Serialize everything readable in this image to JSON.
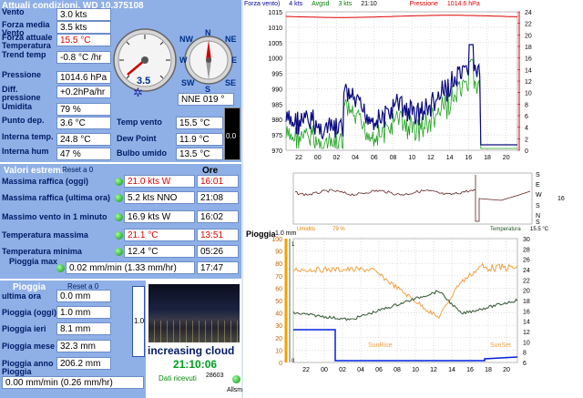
{
  "header": {
    "title": "Attuali condizioni, WD 10.375108"
  },
  "current": [
    {
      "label": "Vento",
      "value": "3.0 kts",
      "cls": ""
    },
    {
      "label": "Forza media Vento",
      "value": "3.5 kts",
      "cls": ""
    },
    {
      "label": "Forza attuale Temperatura",
      "value": "15.5 °C",
      "cls": "red"
    },
    {
      "label": "Trend temp",
      "value": "-0.8 °C /hr",
      "cls": ""
    },
    {
      "label": "Pressione",
      "value": "1014.6 hPa",
      "cls": ""
    },
    {
      "label": "Diff. pressione",
      "value": "+0.2hPa/hr",
      "cls": ""
    },
    {
      "label": "Umidita",
      "value": "79 %",
      "cls": ""
    },
    {
      "label": "Punto dep.",
      "value": "3.6 °C",
      "cls": ""
    },
    {
      "label": "Interna temp.",
      "value": "24.8 °C",
      "cls": ""
    },
    {
      "label": "Interna hum",
      "value": "47 %",
      "cls": ""
    }
  ],
  "gauges": {
    "speed_value": "3.5",
    "direction_text": "NNE 019 °",
    "side_value": "0.0",
    "compass": [
      "N",
      "NE",
      "E",
      "SE",
      "S",
      "SW",
      "W",
      "NW"
    ]
  },
  "derived": [
    {
      "label": "Temp vento",
      "value": "15.5 °C"
    },
    {
      "label": "Dew Point",
      "value": "11.9 °C"
    },
    {
      "label": "Bulbo umido",
      "value": "13.5 °C"
    }
  ],
  "extremes": {
    "title": "Valori estremi",
    "reset": "Reset a 0",
    "ore_label": "Ore",
    "rows": [
      {
        "label": "Massima raffica (oggi)",
        "value": "21.0 kts  W",
        "cls": "red",
        "time": "16:01",
        "time_cls": "red"
      },
      {
        "label": "Massima raffica (ultima ora)",
        "value": "5.2 kts NNO",
        "cls": "",
        "time": "21:08",
        "time_cls": ""
      },
      {
        "label": "Massimo vento in 1 minuto",
        "value": "16.9 kts  W",
        "cls": "",
        "time": "16:02",
        "time_cls": ""
      },
      {
        "label": "Temperatura massima",
        "value": "21.1 °C",
        "cls": "red",
        "time": "13:51",
        "time_cls": "red"
      },
      {
        "label": "Temperatura minima",
        "value": "12.4 °C",
        "cls": "",
        "time": "05:26",
        "time_cls": ""
      },
      {
        "label": "Pioggia max",
        "value": "0.02 mm/min (1.33 mm/hr)",
        "cls": "",
        "time": "17:47",
        "time_cls": ""
      }
    ]
  },
  "rain": {
    "title": "Pioggia",
    "reset": "Reset a 0",
    "rows": [
      {
        "label": "ultima ora",
        "value": "0.0 mm"
      },
      {
        "label": "Pioggia (oggi)",
        "value": "1.0 mm"
      },
      {
        "label": "Pioggia ieri",
        "value": "8.1 mm"
      },
      {
        "label": "Pioggia mese",
        "value": "32.3 mm"
      },
      {
        "label": "Pioggia anno",
        "value": "206.2 mm"
      }
    ],
    "rate_label": "Pioggia",
    "rate_value": "0.00 mm/min (0.26 mm/hr)",
    "bar_value": "1.0"
  },
  "webcam": {
    "caption": "increasing cloud",
    "time": "21:10:06",
    "received_label": "Dati ricevuti",
    "received_count": "28603",
    "alarm": "Allsm"
  },
  "chart_top": {
    "legend": [
      {
        "text": "Forza vento)",
        "color": "#0000a0"
      },
      {
        "text": "4 kts",
        "color": "#0000a0"
      },
      {
        "text": "Avgsd",
        "color": "#008000"
      },
      {
        "text": "3 kts",
        "color": "#008000"
      },
      {
        "text": "21:10",
        "color": "#000"
      },
      {
        "text": "Pressione",
        "color": "#e00000"
      },
      {
        "text": "1014.6 hPa",
        "color": "#e00000"
      }
    ],
    "y_left": [
      "1015",
      "1010",
      "1005",
      "1000",
      "995",
      "990",
      "985",
      "980",
      "975",
      "970"
    ],
    "y_right": [
      "24",
      "22",
      "20",
      "18",
      "16",
      "14",
      "12",
      "10",
      "8",
      "6",
      "4",
      "2",
      "0"
    ],
    "x": [
      "22",
      "00",
      "02",
      "04",
      "06",
      "08",
      "10",
      "12",
      "14",
      "16",
      "18",
      "20"
    ]
  },
  "chart_dir": {
    "labels": [
      "S",
      "E",
      "W",
      "S",
      "N",
      "S"
    ],
    "value": "16"
  },
  "chart_bottom": {
    "rain_label": "Pioggia",
    "rain_val": "1.0 mm",
    "hum_label": "Umidits",
    "hum_val": "79 %",
    "temp_label": "Temperatura",
    "temp_val": "15.5 °C",
    "y_left": [
      "100",
      "90",
      "80",
      "70",
      "60",
      "50",
      "40",
      "30",
      "20",
      "10",
      "0"
    ],
    "y_right": [
      "30",
      "28",
      "26",
      "24",
      "22",
      "20",
      "18",
      "16",
      "14",
      "12",
      "10",
      "8",
      "6"
    ],
    "y_rain": [
      "1",
      "0"
    ],
    "x": [
      "22",
      "00",
      "02",
      "04",
      "06",
      "08",
      "10",
      "12",
      "14",
      "16",
      "18",
      "20"
    ],
    "sunrise": "SunRise",
    "sunset": "SunSet"
  }
}
